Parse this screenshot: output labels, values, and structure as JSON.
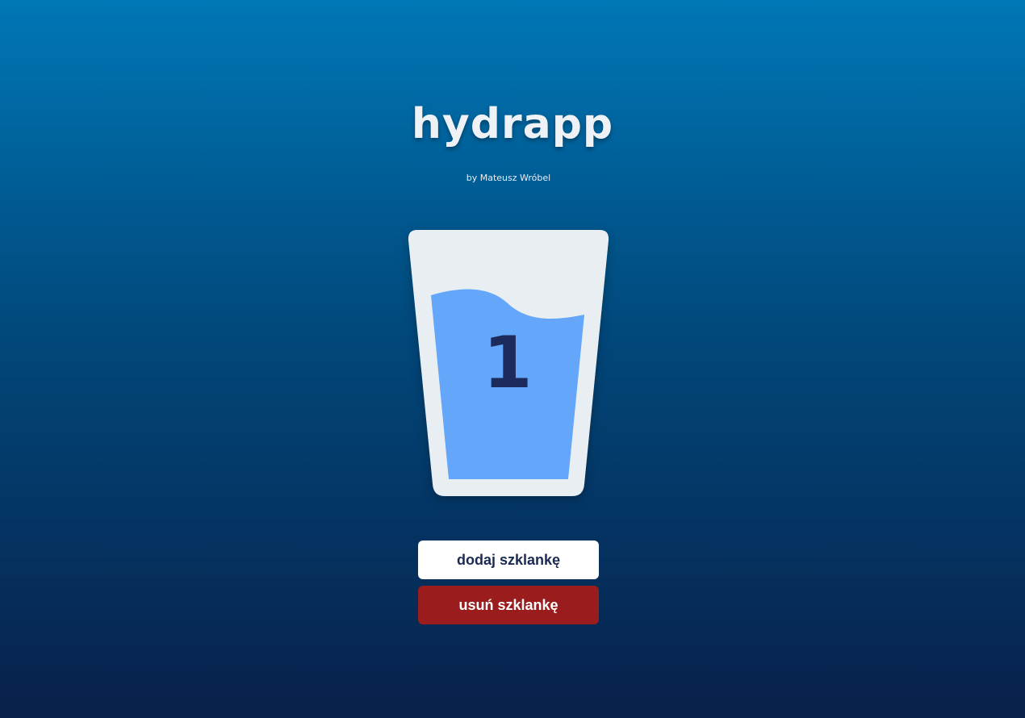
{
  "header": {
    "title": "hydrapp",
    "byline": "by Mateusz Wróbel"
  },
  "glass": {
    "count": "1",
    "fill_level": 0.78,
    "glass_color": "#e9eef2",
    "water_color": "#64a6f9",
    "number_color": "#1d2b5c"
  },
  "actions": {
    "add_label": "dodaj szklankę",
    "remove_label": "usuń szklankę"
  },
  "colors": {
    "background_top": "#0077b6",
    "background_bottom": "#08204a",
    "add_button_bg": "#ffffff",
    "remove_button_bg": "#9b1c1c"
  }
}
